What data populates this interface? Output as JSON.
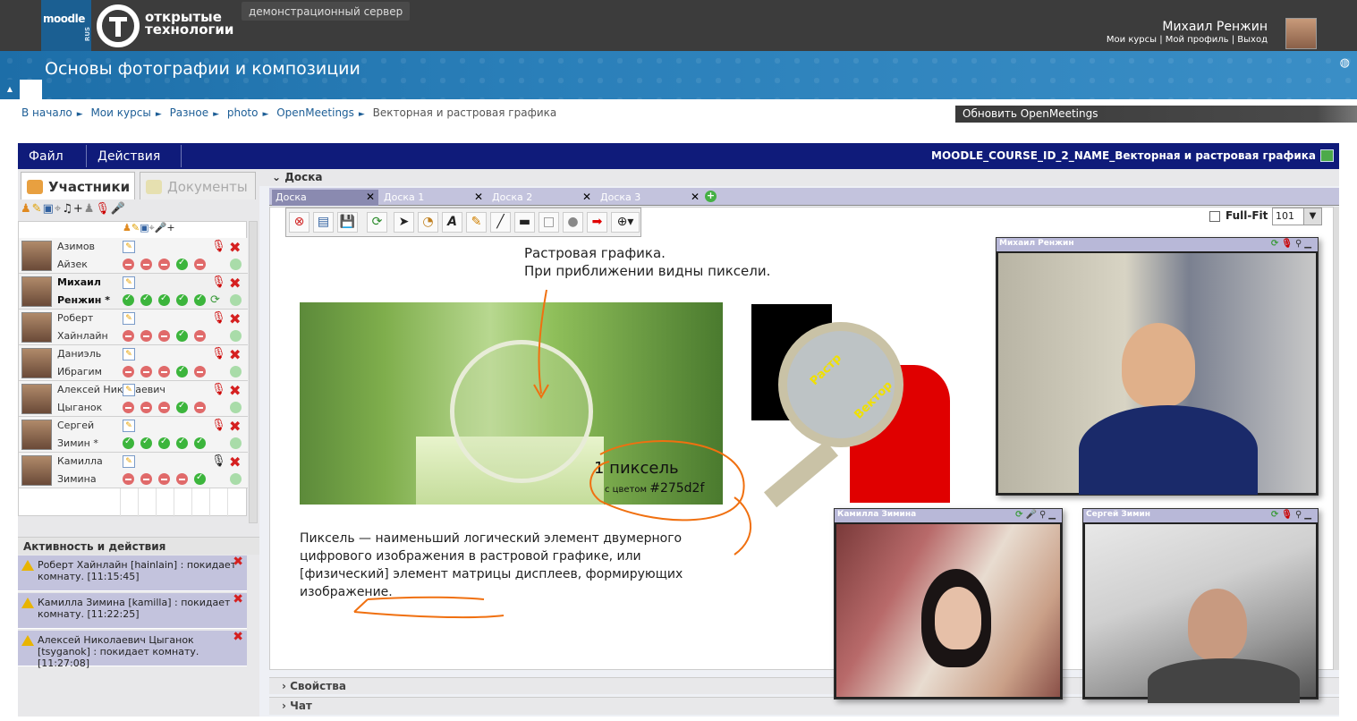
{
  "topbar": {
    "moodle_logo_text": "moodle",
    "moodle_logo_sub": "RUS",
    "ot_logo_line1": "открытые",
    "ot_logo_line2": "технологии",
    "server_tag": "демонстрационный сервер",
    "user_name": "Михаил Ренжин",
    "links": [
      "Мои курсы",
      "Мой профиль",
      "Выход"
    ],
    "link_separator": "|"
  },
  "banner": {
    "course_title": "Основы фотографии и композиции",
    "collapse_icon": "▲",
    "lang_icon": "globe-icon"
  },
  "breadcrumb": {
    "items": [
      "В начало",
      "Мои курсы",
      "Разное",
      "photo",
      "OpenMeetings",
      "Векторная и растровая графика"
    ],
    "separator": "►",
    "update_button": "Обновить OpenMeetings"
  },
  "app": {
    "menu": {
      "file": "Файл",
      "actions": "Действия"
    },
    "room_title": "MOODLE_COURSE_ID_2_NAME_Векторная и растровая графика",
    "tabs": {
      "users": "Участники",
      "documents": "Документы"
    },
    "participants": [
      {
        "first": "Азимов",
        "last": "Айзек",
        "me": false,
        "statuses": [
          "r",
          "r",
          "r",
          "g",
          "r"
        ],
        "mic_muted": true,
        "sync": false
      },
      {
        "first": "Михаил",
        "last": "Ренжин *",
        "me": true,
        "statuses": [
          "g",
          "g",
          "g",
          "g",
          "g"
        ],
        "mic_muted": true,
        "sync": true
      },
      {
        "first": "Роберт",
        "last": "Хайнлайн",
        "me": false,
        "statuses": [
          "r",
          "r",
          "r",
          "g",
          "r"
        ],
        "mic_muted": true,
        "sync": false
      },
      {
        "first": "Даниэль",
        "last": "Ибрагим",
        "me": false,
        "statuses": [
          "r",
          "r",
          "r",
          "g",
          "r"
        ],
        "mic_muted": true,
        "sync": false
      },
      {
        "first": "Алексей Николаевич",
        "last": "Цыганок",
        "me": false,
        "statuses": [
          "r",
          "r",
          "r",
          "g",
          "r"
        ],
        "mic_muted": true,
        "sync": false
      },
      {
        "first": "Сергей",
        "last": "Зимин *",
        "me": false,
        "statuses": [
          "g",
          "g",
          "g",
          "g",
          "g"
        ],
        "mic_muted": true,
        "sync": false
      },
      {
        "first": "Камилла",
        "last": "Зимина",
        "me": false,
        "statuses": [
          "r",
          "r",
          "r",
          "r",
          "g"
        ],
        "mic_muted": false,
        "sync": false
      }
    ],
    "activity": {
      "title": "Активность и действия",
      "items": [
        "Роберт Хайнлайн [hainlain] : покидает комнату. [11:15:45]",
        "Камилла Зимина [kamilla] : покидает комнату. [11:22:25]",
        "Алексей Николаевич Цыганок [tsyganok] : покидает комнату. [11:27:08]"
      ]
    },
    "whiteboard": {
      "section_title": "Доска",
      "tabs": [
        "Доска",
        "Доска 1",
        "Доска 2",
        "Доска 3"
      ],
      "active_tab": "Доска",
      "fullfit_label": "Full-Fit",
      "zoom_value": "101",
      "text_raster": [
        "Растровая графика.",
        "При приближении видны пиксели."
      ],
      "pixel_label": "1 пиксель",
      "pixel_color_prefix": "с цветом",
      "pixel_color_value": "#275d2f",
      "magnifier_raster": "Растр",
      "magnifier_vector": "Вектор",
      "definition": "Пиксель — наименьший логический элемент двумерного цифрового изображения в растровой графике, или [физический] элемент матрицы дисплеев, формирующих изображение."
    },
    "bottom": {
      "properties": "Свойства",
      "chat": "Чат"
    },
    "videos": [
      {
        "name": "Михаил Ренжин"
      },
      {
        "name": "Камилла Зимина"
      },
      {
        "name": "Сергей Зимин"
      }
    ]
  },
  "colors": {
    "menubar": "#0f1b7a",
    "banner": "#1d6ea8",
    "annotation_orange": "#f07010",
    "tab_lilac": "#c3c3dd"
  }
}
